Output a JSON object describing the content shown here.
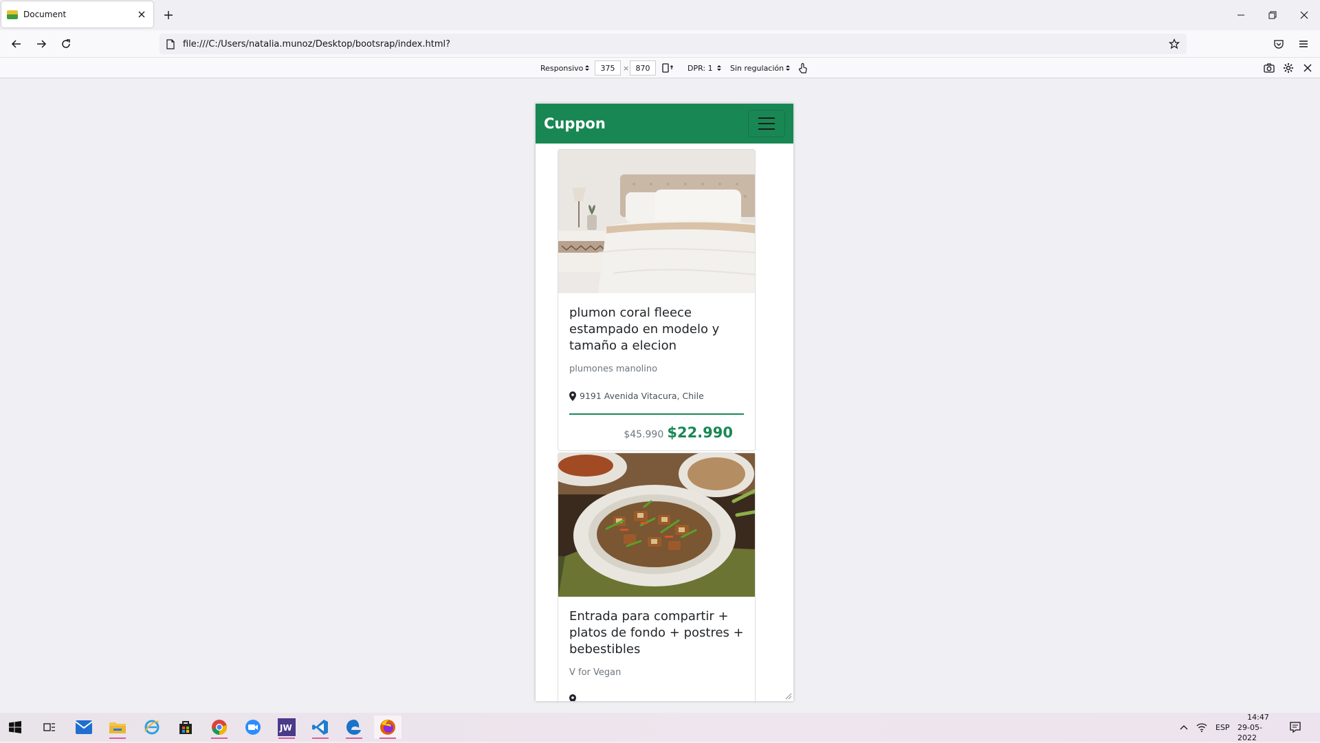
{
  "browser": {
    "tab_title": "Document",
    "url": "file:///C:/Users/natalia.munoz/Desktop/bootsrap/index.html?"
  },
  "responsive_toolbar": {
    "device": "Responsivo",
    "width": "375",
    "times": "×",
    "height": "870",
    "dpr": "DPR: 1",
    "throttling": "Sin regulación"
  },
  "page": {
    "brand": "Cuppon",
    "cards": [
      {
        "title": "plumon coral fleece estampado en modelo y tamaño a elecion",
        "subtitle": "plumones manolino",
        "address": "9191 Avenida Vitacura, Chile",
        "old_price": "$45.990",
        "new_price": "$22.990"
      },
      {
        "title": "Entrada para compartir + platos de fondo + postres + bebestibles",
        "subtitle": "V for Vegan"
      }
    ]
  },
  "taskbar": {
    "lang": "ESP",
    "time": "14:47",
    "date": "29-05-2022"
  },
  "colors": {
    "brand_green": "#198754",
    "taskbar_accent": "#d45fa0"
  }
}
